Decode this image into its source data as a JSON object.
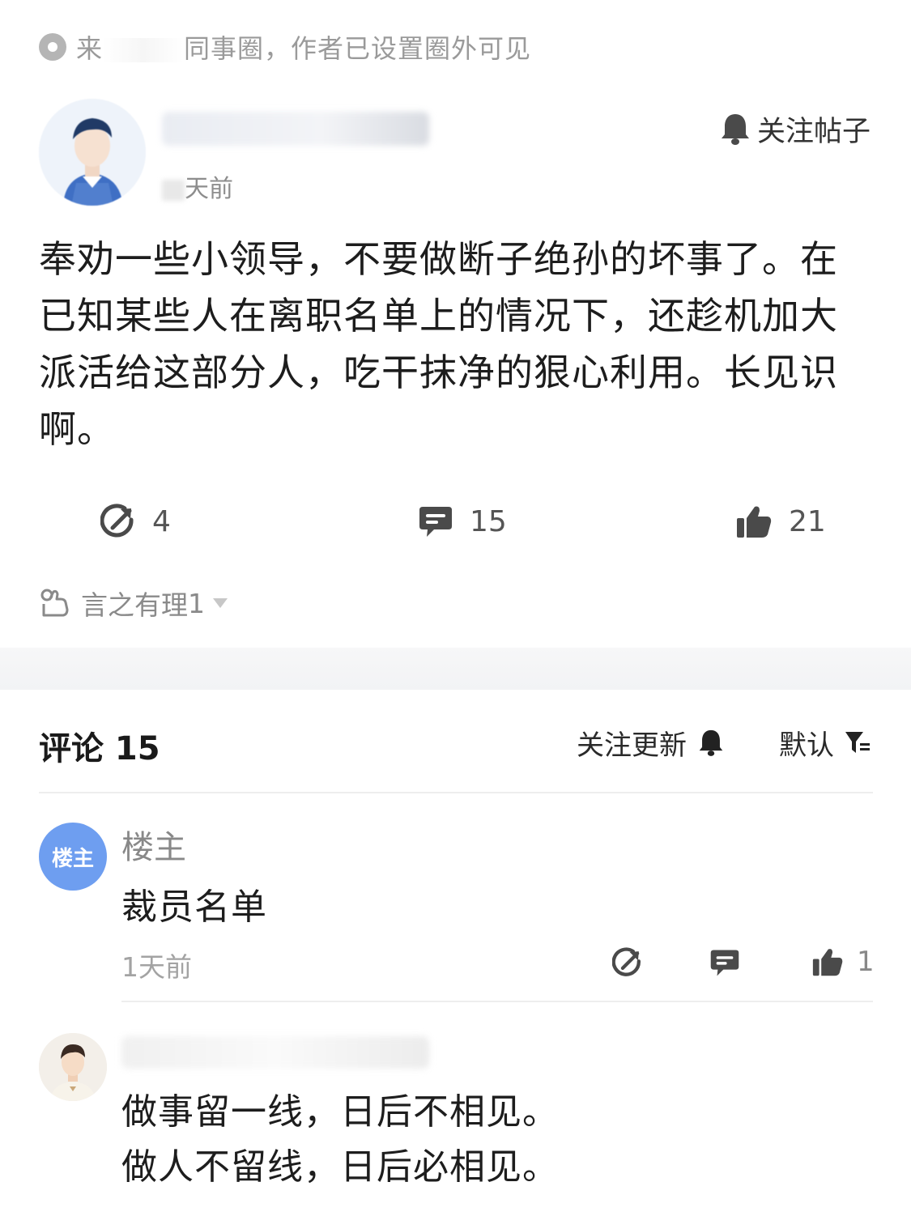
{
  "source": {
    "text_prefix": "来",
    "text_suffix": "同事圈，作者已设置圈外可见"
  },
  "author": {
    "name": "",
    "time_suffix": "天前"
  },
  "follow_post_label": "关注帖子",
  "post": {
    "lines": [
      "奉劝一些小领导，不要做断子绝孙的坏事了。在",
      "已知某些人在离职名单上的情况下，还趁机加大",
      "派活给这部分人，吃干抹净的狠心利用。长见识",
      "啊。"
    ]
  },
  "stats": {
    "shares": "4",
    "comments": "15",
    "likes": "21"
  },
  "reaction": {
    "label": "言之有理",
    "count": "1"
  },
  "comments_header": {
    "title": "评论 15",
    "follow_updates": "关注更新",
    "sort": "默认"
  },
  "comments": [
    {
      "badge": "楼主",
      "name": "楼主",
      "text": "裁员名单",
      "time": "1天前",
      "likes": "1"
    },
    {
      "name": "",
      "lines": [
        "做事留一线，日后不相见。",
        "做人不留线，日后必相见。"
      ]
    }
  ],
  "icons": {
    "source": "circle-dot-icon",
    "follow": "bell-icon",
    "share": "share-arrow-icon",
    "comment": "comment-bubble-icon",
    "like": "thumbs-up-icon",
    "reaction": "reaction-emoji-icon",
    "sort": "filter-icon"
  },
  "colors": {
    "op_badge": "#6e9ef0",
    "muted_text": "#9a9a9a",
    "icon": "#444444"
  }
}
